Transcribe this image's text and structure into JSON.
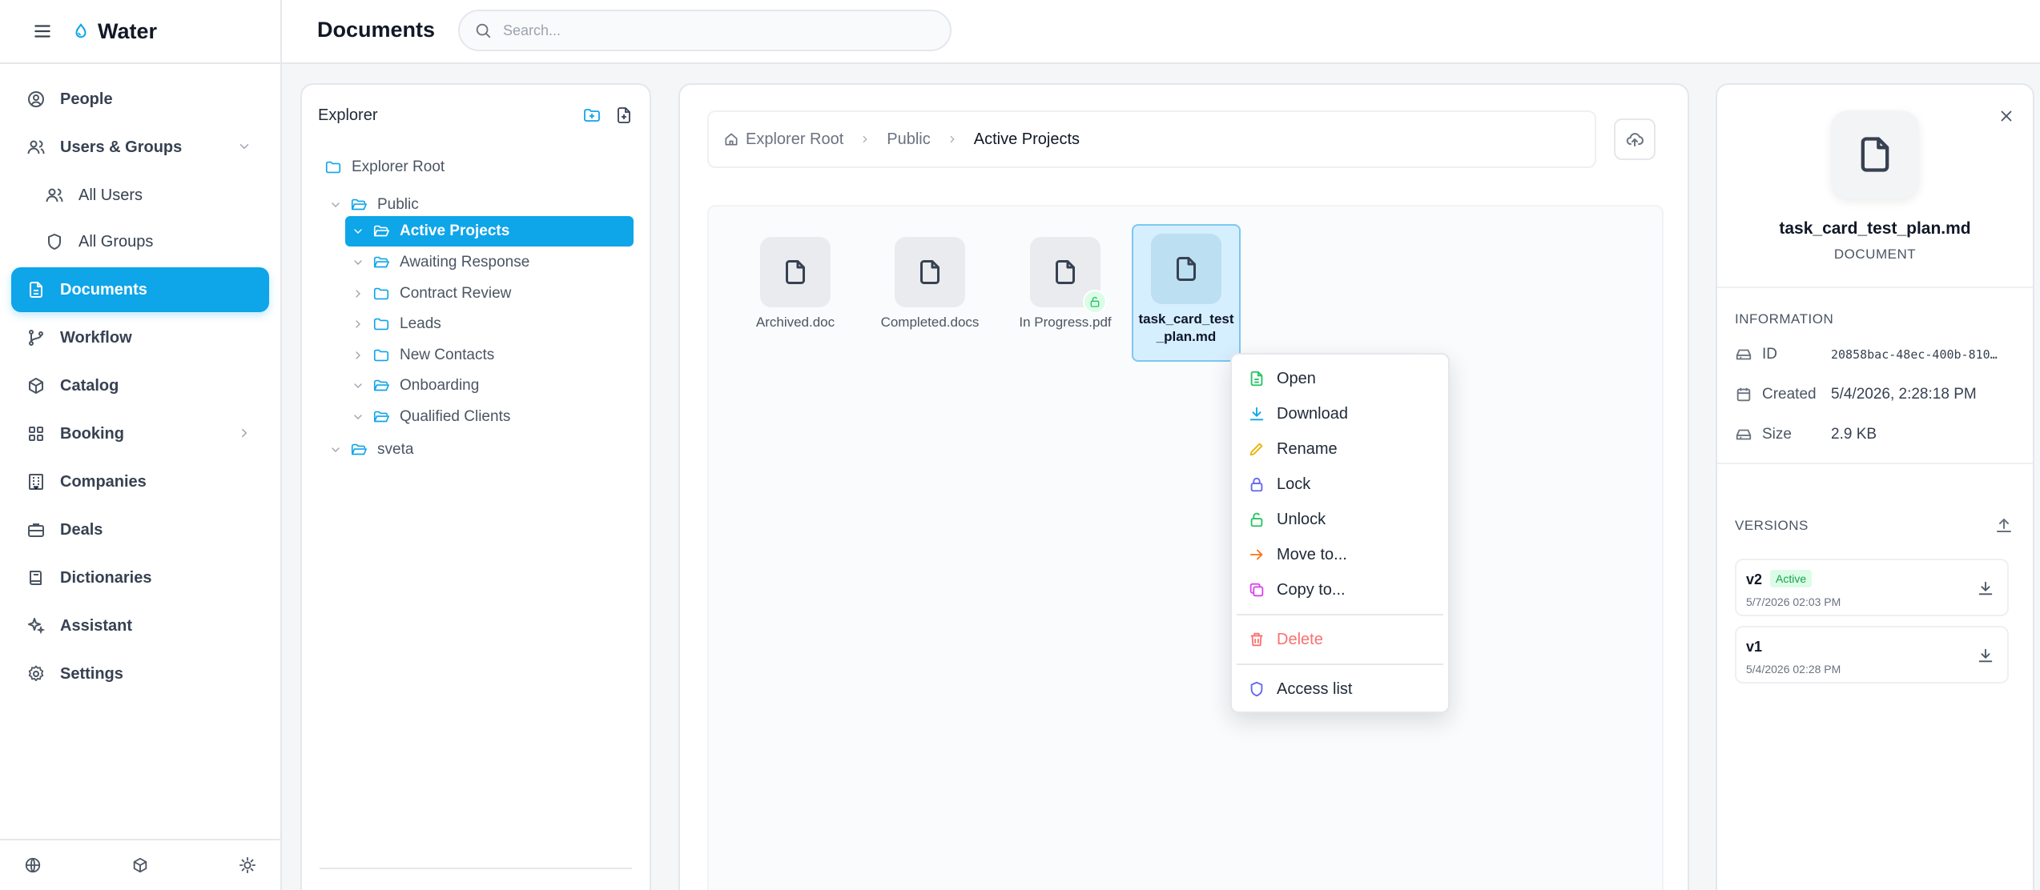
{
  "app": {
    "name": "Water",
    "brand_color": "#0ea5e9"
  },
  "sidebar": {
    "items": [
      {
        "label": "People",
        "icon": "user-circle-icon"
      },
      {
        "label": "Users & Groups",
        "icon": "users-icon"
      },
      {
        "label": "All Users",
        "icon": "users-icon"
      },
      {
        "label": "All Groups",
        "icon": "shield-icon"
      },
      {
        "label": "Documents",
        "icon": "document-icon",
        "active": true
      },
      {
        "label": "Workflow",
        "icon": "git-branch-icon"
      },
      {
        "label": "Catalog",
        "icon": "box-icon"
      },
      {
        "label": "Booking",
        "icon": "grid-icon"
      },
      {
        "label": "Companies",
        "icon": "building-icon"
      },
      {
        "label": "Deals",
        "icon": "briefcase-icon"
      },
      {
        "label": "Dictionaries",
        "icon": "book-icon"
      },
      {
        "label": "Assistant",
        "icon": "sparkles-icon"
      },
      {
        "label": "Settings",
        "icon": "gear-icon"
      }
    ],
    "footer_icons": [
      "globe-icon",
      "cube-icon",
      "sun-icon"
    ]
  },
  "header": {
    "title": "Documents",
    "search_placeholder": "Search..."
  },
  "explorer": {
    "title": "Explorer",
    "tree": [
      {
        "label": "Explorer Root"
      },
      {
        "label": "Public"
      },
      {
        "label": "Active Projects",
        "selected": true
      },
      {
        "label": "Awaiting Response"
      },
      {
        "label": "Contract Review"
      },
      {
        "label": "Leads"
      },
      {
        "label": "New Contacts"
      },
      {
        "label": "Onboarding"
      },
      {
        "label": "Qualified Clients"
      },
      {
        "label": "sveta"
      }
    ]
  },
  "breadcrumb": [
    "Explorer Root",
    "Public",
    "Active Projects"
  ],
  "files": [
    {
      "name": "Archived.doc"
    },
    {
      "name": "Completed.docs"
    },
    {
      "name": "In Progress.pdf",
      "locked": true
    },
    {
      "name": "task_card_test_plan.md",
      "selected": true
    }
  ],
  "context_menu": {
    "items": [
      {
        "label": "Open",
        "icon": "file-text-icon",
        "color": "#22c55e"
      },
      {
        "label": "Download",
        "icon": "download-icon",
        "color": "#0ea5e9"
      },
      {
        "label": "Rename",
        "icon": "pencil-icon",
        "color": "#eab308"
      },
      {
        "label": "Lock",
        "icon": "lock-icon",
        "color": "#6366f1"
      },
      {
        "label": "Unlock",
        "icon": "unlock-icon",
        "color": "#22c55e"
      },
      {
        "label": "Move to...",
        "icon": "arrow-right-icon",
        "color": "#f97316"
      },
      {
        "label": "Copy to...",
        "icon": "copy-icon",
        "color": "#d946ef"
      }
    ],
    "delete_label": "Delete",
    "delete_color": "#f87171",
    "access_label": "Access list",
    "access_color": "#6366f1"
  },
  "details": {
    "name": "task_card_test_plan.md",
    "type": "DOCUMENT",
    "info_title": "INFORMATION",
    "id_label": "ID",
    "id_value": "20858bac-48ec-400b-8108-...",
    "created_label": "Created",
    "created_value": "5/4/2026, 2:28:18 PM",
    "size_label": "Size",
    "size_value": "2.9 KB",
    "versions_title": "VERSIONS",
    "versions": [
      {
        "name": "v2",
        "badge": "Active",
        "date": "5/7/2026 02:03 PM"
      },
      {
        "name": "v1",
        "date": "5/4/2026 02:28 PM"
      }
    ]
  }
}
